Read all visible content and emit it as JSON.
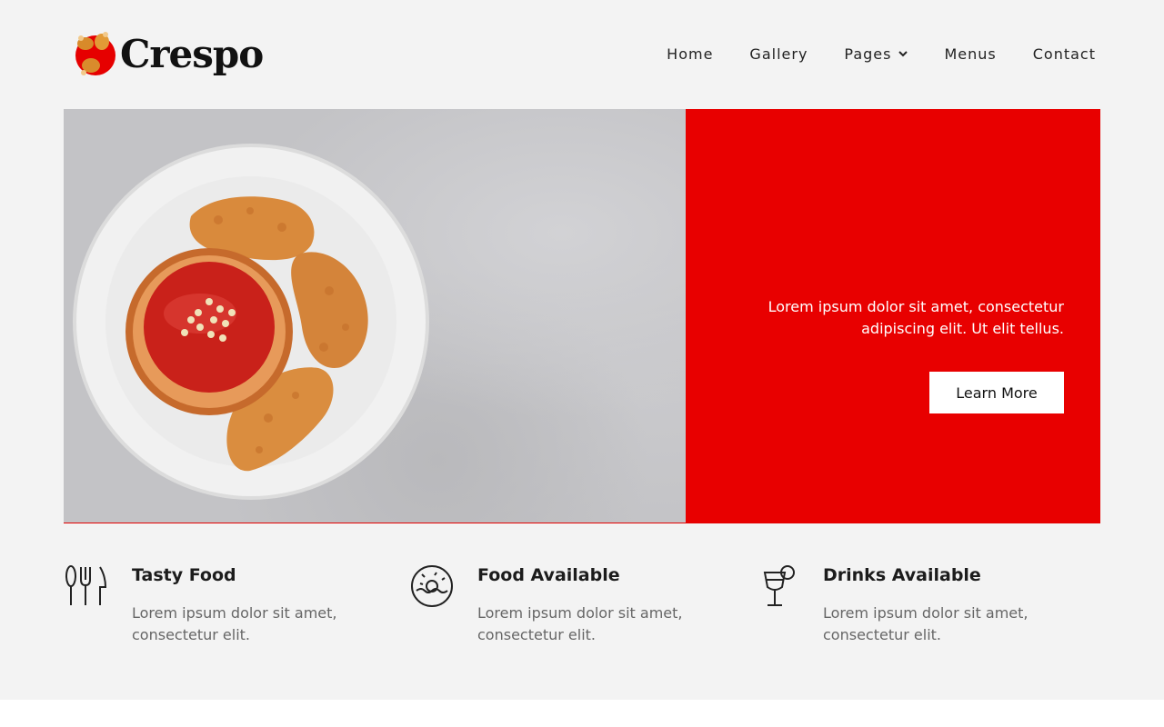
{
  "brand": {
    "name": "Crespo",
    "accent": "#e80000"
  },
  "nav": {
    "items": [
      {
        "label": "Home"
      },
      {
        "label": "Gallery"
      },
      {
        "label": "Pages",
        "dropdown": true
      },
      {
        "label": "Menus"
      },
      {
        "label": "Contact"
      }
    ]
  },
  "hero": {
    "image": "fried-chicken-with-ketchup-bowl",
    "text": "Lorem ipsum dolor sit amet, consectetur adipiscing elit. Ut elit tellus.",
    "button_label": "Learn More"
  },
  "features": [
    {
      "icon": "cutlery-icon",
      "title": "Tasty Food",
      "description": "Lorem ipsum dolor sit amet, consectetur elit."
    },
    {
      "icon": "donut-icon",
      "title": "Food Available",
      "description": "Lorem ipsum dolor sit amet, consectetur elit."
    },
    {
      "icon": "cocktail-glass-icon",
      "title": "Drinks Available",
      "description": "Lorem ipsum dolor sit amet, consectetur elit."
    }
  ]
}
